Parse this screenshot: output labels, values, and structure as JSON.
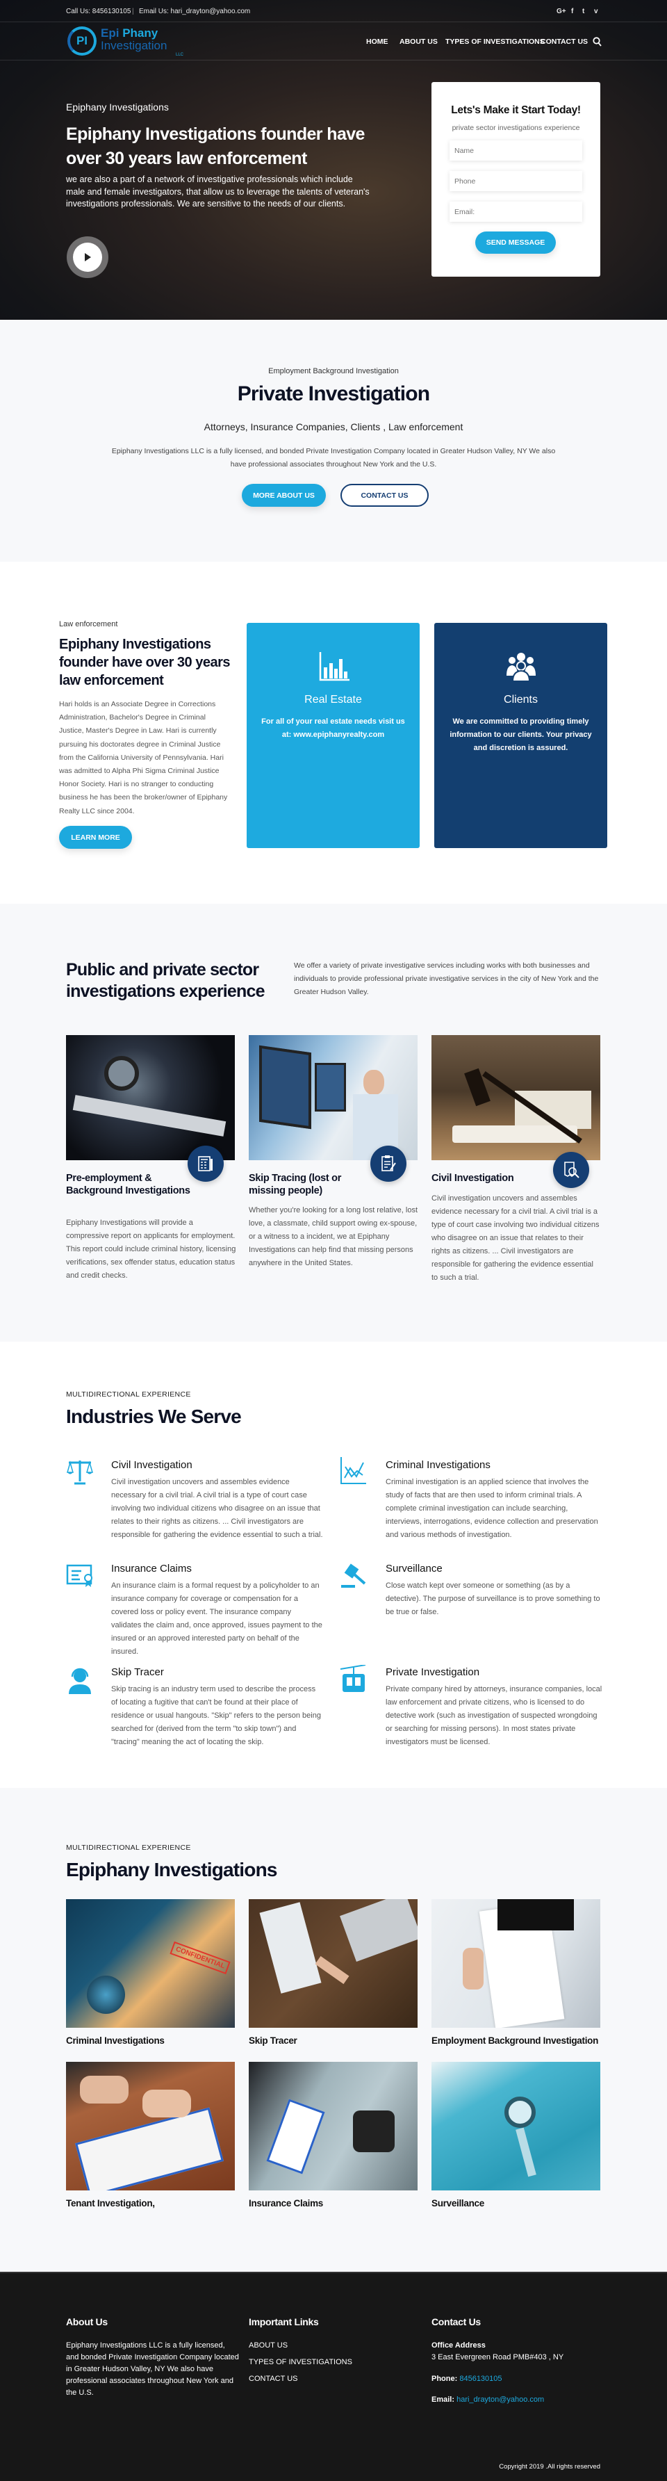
{
  "topbar": {
    "call": "Call Us: 8456130105",
    "email": "Email Us: hari_drayton@yahoo.com",
    "social": [
      "G+",
      "f",
      "t",
      "v"
    ]
  },
  "logo": {
    "line1a": "Epi",
    "line1b": "Phany",
    "line2": "Investigation",
    "llc": "LLC",
    "mark": "PI"
  },
  "nav": {
    "items": [
      "HOME",
      "ABOUT US",
      "TYPES OF INVESTIGATIONS",
      "CONTACT US"
    ]
  },
  "hero": {
    "eyebrow": "Epiphany Investigations",
    "title": "Epiphany Investigations founder have over 30 years law enforcement",
    "text": "we are also a part of a network of investigative professionals which include male and female investigators, that allow us to leverage the talents of veteran's investigations professionals. We are sensitive to the needs of our clients."
  },
  "form": {
    "title": "Lets's Make it Start Today!",
    "subtitle": "private sector investigations experience",
    "name_placeholder": "Name",
    "phone_placeholder": "Phone",
    "email_placeholder": "Email:",
    "submit": "SEND MESSAGE"
  },
  "intro": {
    "eyebrow": "Employment Background Investigation",
    "title": "Private Investigation",
    "tagline": "Attorneys, Insurance Companies, Clients , Law enforcement",
    "text": "Epiphany Investigations LLC is a fully licensed, and bonded Private Investigation Company located in Greater Hudson Valley, NY We also have professional associates throughout New York and the U.S.",
    "btn_more": "MORE ABOUT US",
    "btn_contact": "CONTACT US"
  },
  "about": {
    "eyebrow": "Law enforcement",
    "title": "Epiphany Investigations founder have over 30 years law enforcement",
    "text": "Hari holds is an Associate Degree in Corrections Administration, Bachelor's Degree in Criminal Justice, Master's Degree in Law. Hari is currently pursuing his doctorates degree in Criminal Justice from the California University of Pennsylvania. Hari was admitted to Alpha Phi Sigma Criminal Justice Honor Society. Hari is no stranger to conducting business he has been the broker/owner of Epiphany Realty LLC since 2004.",
    "button": "LEARN MORE",
    "cards": [
      {
        "title": "Real Estate",
        "text": "For all of your real estate needs visit us at: www.epiphanyrealty.com",
        "color": "#1eaadf"
      },
      {
        "title": "Clients",
        "text": "We are committed to providing timely information to our clients. Your privacy and discretion is assured.",
        "color": "#133f70"
      }
    ]
  },
  "sector": {
    "title": "Public and private sector investigations experience",
    "text": "We offer a variety of private investigative services including works with both businesses and individuals to provide professional private investigative services in the city of New York and the Greater Hudson Valley.",
    "cards": [
      {
        "title": "Pre-employment & Background Investigations",
        "text": "Epiphany Investigations will provide a compressive report on applicants for employment. This report could include criminal history, licensing verifications, sex offender status, education status and credit checks."
      },
      {
        "title": "Skip Tracing (lost or missing people)",
        "text": "Whether you're looking for a long lost relative, lost love, a classmate, child support owing ex-spouse, or a witness to a incident, we at Epiphany Investigations can help find that missing persons anywhere in the United States."
      },
      {
        "title": "Civil Investigation",
        "text": "Civil investigation uncovers and assembles evidence necessary for a civil trial. A civil trial is a type of court case involving two individual citizens who disagree on an issue that relates to their rights as citizens. ... Civil investigators are responsible for gathering the evidence essential to such a trial."
      }
    ]
  },
  "industries": {
    "eyebrow": "MULTIDIRECTIONAL EXPERIENCE",
    "title": "Industries We Serve",
    "items": [
      {
        "title": "Civil Investigation",
        "text": "Civil investigation uncovers and assembles evidence necessary for a civil trial. A civil trial is a type of court case involving two individual citizens who disagree on an issue that relates to their rights as citizens. ... Civil investigators are responsible for gathering the evidence essential to such a trial."
      },
      {
        "title": "Criminal Investigations",
        "text": "Criminal investigation is an applied science that involves the study of facts that are then used to inform criminal trials. A complete criminal investigation can include searching, interviews, interrogations, evidence collection and preservation and various methods of investigation."
      },
      {
        "title": "Insurance Claims",
        "text": "An insurance claim is a formal request by a policyholder to an insurance company for coverage or compensation for a covered loss or policy event. The insurance company validates the claim and, once approved, issues payment to the insured or an approved interested party on behalf of the insured."
      },
      {
        "title": "Surveillance",
        "text": "Close watch kept over someone or something (as by a detective). The purpose of surveillance is to prove something to be true or false."
      },
      {
        "title": "Skip Tracer",
        "text": "Skip tracing is an industry term used to describe the process of locating a fugitive that can't be found at their place of residence or usual hangouts. \"Skip\" refers to the person being searched for (derived from the term \"to skip town\") and \"tracing\" meaning the act of locating the skip."
      },
      {
        "title": "Private Investigation",
        "text": "Private company hired by attorneys, insurance companies, local law enforcement and private citizens, who is licensed to do detective work (such as investigation of suspected wrongdoing or searching for missing persons). In most states private investigators must be licensed."
      }
    ]
  },
  "gallery": {
    "eyebrow": "MULTIDIRECTIONAL EXPERIENCE",
    "title": "Epiphany Investigations",
    "items": [
      "Criminal Investigations",
      "Skip Tracer",
      "Employment Background Investigation",
      "Tenant Investigation,",
      "Insurance Claims",
      "Surveillance"
    ],
    "stamp": "CONFIDENTIAL"
  },
  "footer": {
    "about_title": "About Us",
    "about_text": "Epiphany Investigations LLC is a fully licensed, and bonded Private Investigation Company located in Greater Hudson Valley, NY We also have professional associates throughout New York and the U.S.",
    "links_title": "Important Links",
    "links": [
      "ABOUT US",
      "TYPES OF INVESTIGATIONS",
      "CONTACT US"
    ],
    "contact_title": "Contact Us",
    "office_label": "Office Address",
    "address": "3 East Evergreen Road PMB#403 , NY",
    "phone_label": "Phone:",
    "phone": "8456130105",
    "email_label": "Email:",
    "email": "hari_drayton@yahoo.com",
    "copyright": "Copyright 2019 .All rights reserved"
  },
  "colors": {
    "accent": "#1da9de",
    "navy": "#133f70",
    "footer": "#171717"
  }
}
